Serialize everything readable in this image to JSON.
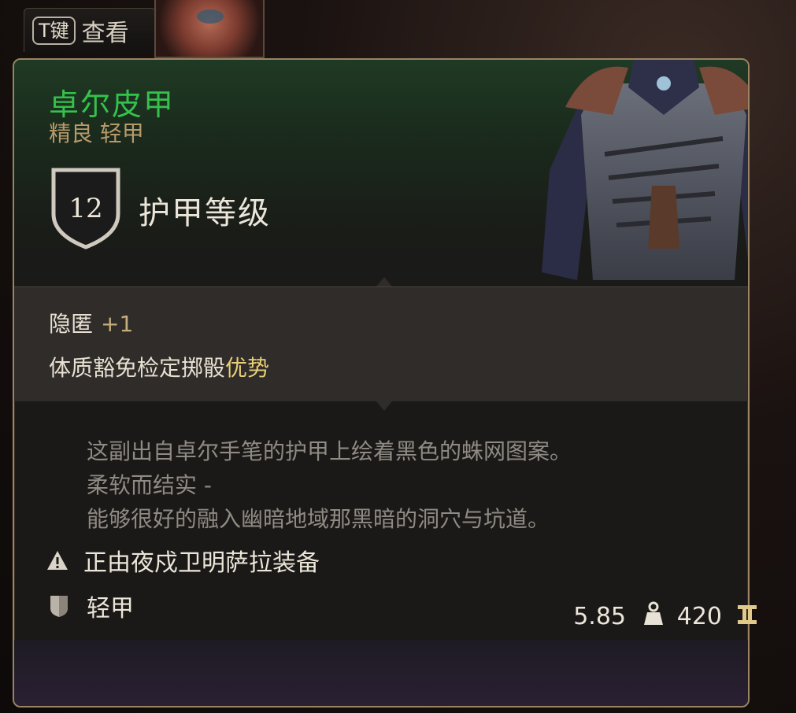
{
  "hint": {
    "key": "T键",
    "label": "查看"
  },
  "item": {
    "name": "卓尔皮甲",
    "subtitle": "精良 轻甲",
    "armor_class": "12",
    "armor_class_label": "护甲等级"
  },
  "stats": {
    "stealth_label": "隐匿",
    "stealth_value": "+1",
    "constitution_text": "体质豁免检定掷骰",
    "constitution_adv": "优势"
  },
  "description": {
    "line1": "这副出自卓尔手笔的护甲上绘着黑色的蛛网图案。",
    "line2": "柔软而结实 -",
    "line3": "能够很好的融入幽暗地域那黑暗的洞穴与坑道。"
  },
  "equipped_text": "正由夜戍卫明萨拉装备",
  "armor_type": "轻甲",
  "footer": {
    "weight": "5.85",
    "price": "420"
  },
  "colors": {
    "rarity_green": "#35c24b",
    "border_gold": "#9a8463",
    "advantage_yellow": "#e7cf7a"
  },
  "icons": [
    "shield-icon",
    "warning-icon",
    "armor-type-icon",
    "weight-icon",
    "gold-icon"
  ]
}
